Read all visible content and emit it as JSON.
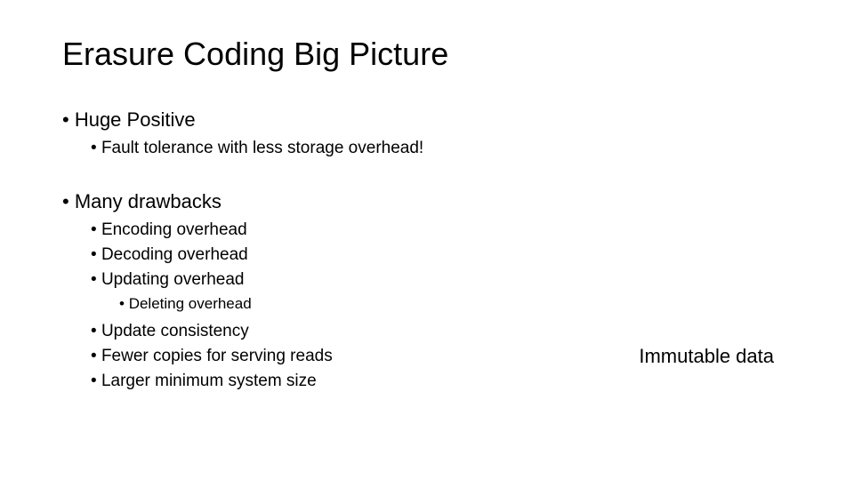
{
  "title": "Erasure Coding Big Picture",
  "sections": [
    {
      "heading": "Huge Positive",
      "sub": [
        "Fault tolerance with less storage overhead!"
      ]
    },
    {
      "heading": "Many drawbacks",
      "sub": [
        "Encoding overhead",
        "Decoding overhead",
        "Updating overhead"
      ],
      "subsub": [
        "Deleting overhead"
      ],
      "sub2": [
        "Update consistency",
        "Fewer copies for serving reads",
        "Larger minimum system size"
      ]
    }
  ],
  "annotation": "Immutable data"
}
